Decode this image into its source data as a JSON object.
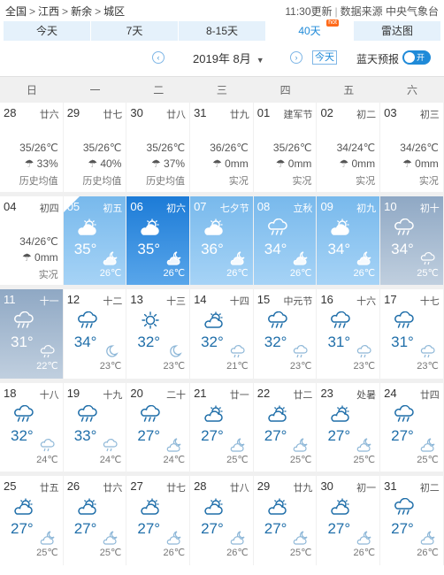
{
  "breadcrumb": {
    "items": [
      "全国",
      "江西",
      "新余",
      "城区"
    ],
    "sep": ">"
  },
  "update": {
    "time": "11:30更新",
    "source": "数据来源 中央气象台"
  },
  "tabs": [
    {
      "label": "今天",
      "active": false
    },
    {
      "label": "7天",
      "active": false
    },
    {
      "label": "8-15天",
      "active": false
    },
    {
      "label": "40天",
      "active": true,
      "badge": "hot"
    },
    {
      "label": "雷达图",
      "active": false
    }
  ],
  "controls": {
    "prev_icon": "‹",
    "next_icon": "›",
    "month": "2019年 8月",
    "caret": "▼",
    "today": "今天",
    "bluesky": "蓝天预报",
    "toggle": "开"
  },
  "weekdays": [
    "日",
    "一",
    "二",
    "三",
    "四",
    "五",
    "六"
  ],
  "history": [
    {
      "day": "28",
      "lunar": "廿六",
      "temp": "35/26℃",
      "prob": "33%",
      "note": "历史均值"
    },
    {
      "day": "29",
      "lunar": "廿七",
      "temp": "35/26℃",
      "prob": "40%",
      "note": "历史均值"
    },
    {
      "day": "30",
      "lunar": "廿八",
      "temp": "35/26℃",
      "prob": "37%",
      "note": "历史均值"
    },
    {
      "day": "31",
      "lunar": "廿九",
      "temp": "36/26℃",
      "prob": "0mm",
      "note": "实况"
    },
    {
      "day": "01",
      "lunar": "建军节",
      "temp": "35/26℃",
      "prob": "0mm",
      "note": "实况"
    },
    {
      "day": "02",
      "lunar": "初二",
      "temp": "34/24℃",
      "prob": "0mm",
      "note": "实况"
    },
    {
      "day": "03",
      "lunar": "初三",
      "temp": "34/26℃",
      "prob": "0mm",
      "note": "实况"
    },
    {
      "day": "04",
      "lunar": "初四",
      "temp": "34/26℃",
      "prob": "0mm",
      "note": "实况"
    }
  ],
  "forecast": [
    {
      "day": "05",
      "lunar": "初五",
      "hi": "35°",
      "lo": "26℃",
      "icon": "partly-cloudy",
      "night": "partly-cloudy-night",
      "style": "sky"
    },
    {
      "day": "06",
      "lunar": "初六",
      "hi": "35°",
      "lo": "26℃",
      "icon": "partly-cloudy",
      "night": "partly-cloudy-night",
      "style": "skydark"
    },
    {
      "day": "07",
      "lunar": "七夕节",
      "hi": "36°",
      "lo": "26℃",
      "icon": "partly-cloudy",
      "night": "partly-cloudy-night",
      "style": "sky"
    },
    {
      "day": "08",
      "lunar": "立秋",
      "hi": "34°",
      "lo": "26℃",
      "icon": "rain",
      "night": "partly-cloudy-night",
      "style": "sky"
    },
    {
      "day": "09",
      "lunar": "初九",
      "hi": "34°",
      "lo": "26℃",
      "icon": "partly-cloudy",
      "night": "partly-cloudy-night",
      "style": "sky"
    },
    {
      "day": "10",
      "lunar": "初十",
      "hi": "34°",
      "lo": "25℃",
      "icon": "rain",
      "night": "rain",
      "style": "grey"
    },
    {
      "day": "11",
      "lunar": "十一",
      "hi": "31°",
      "lo": "22℃",
      "icon": "rain",
      "night": "rain",
      "style": "grey"
    },
    {
      "day": "12",
      "lunar": "十二",
      "hi": "34°",
      "lo": "23℃",
      "icon": "rain",
      "night": "moon",
      "style": ""
    },
    {
      "day": "13",
      "lunar": "十三",
      "hi": "32°",
      "lo": "23℃",
      "icon": "sun",
      "night": "moon",
      "style": ""
    },
    {
      "day": "14",
      "lunar": "十四",
      "hi": "32°",
      "lo": "21℃",
      "icon": "partly-cloudy",
      "night": "rain",
      "style": ""
    },
    {
      "day": "15",
      "lunar": "中元节",
      "hi": "32°",
      "lo": "23℃",
      "icon": "rain",
      "night": "rain",
      "style": ""
    },
    {
      "day": "16",
      "lunar": "十六",
      "hi": "31°",
      "lo": "23℃",
      "icon": "rain",
      "night": "rain",
      "style": ""
    },
    {
      "day": "17",
      "lunar": "十七",
      "hi": "31°",
      "lo": "23℃",
      "icon": "rain",
      "night": "rain",
      "style": ""
    },
    {
      "day": "18",
      "lunar": "十八",
      "hi": "32°",
      "lo": "24℃",
      "icon": "rain",
      "night": "rain",
      "style": ""
    },
    {
      "day": "19",
      "lunar": "十九",
      "hi": "33°",
      "lo": "24℃",
      "icon": "rain",
      "night": "rain",
      "style": ""
    },
    {
      "day": "20",
      "lunar": "二十",
      "hi": "27°",
      "lo": "24℃",
      "icon": "rain",
      "night": "partly-cloudy-night",
      "style": ""
    },
    {
      "day": "21",
      "lunar": "廿一",
      "hi": "27°",
      "lo": "25℃",
      "icon": "partly-cloudy",
      "night": "partly-cloudy-night",
      "style": ""
    },
    {
      "day": "22",
      "lunar": "廿二",
      "hi": "27°",
      "lo": "25℃",
      "icon": "partly-cloudy",
      "night": "partly-cloudy-night",
      "style": ""
    },
    {
      "day": "23",
      "lunar": "处暑",
      "hi": "27°",
      "lo": "25℃",
      "icon": "partly-cloudy",
      "night": "partly-cloudy-night",
      "style": ""
    },
    {
      "day": "24",
      "lunar": "廿四",
      "hi": "27°",
      "lo": "25℃",
      "icon": "rain",
      "night": "partly-cloudy-night",
      "style": ""
    },
    {
      "day": "25",
      "lunar": "廿五",
      "hi": "27°",
      "lo": "25℃",
      "icon": "partly-cloudy",
      "night": "partly-cloudy-night",
      "style": ""
    },
    {
      "day": "26",
      "lunar": "廿六",
      "hi": "27°",
      "lo": "25℃",
      "icon": "partly-cloudy",
      "night": "partly-cloudy-night",
      "style": ""
    },
    {
      "day": "27",
      "lunar": "廿七",
      "hi": "27°",
      "lo": "26℃",
      "icon": "partly-cloudy",
      "night": "partly-cloudy-night",
      "style": ""
    },
    {
      "day": "28",
      "lunar": "廿八",
      "hi": "27°",
      "lo": "26℃",
      "icon": "partly-cloudy",
      "night": "partly-cloudy-night",
      "style": ""
    },
    {
      "day": "29",
      "lunar": "廿九",
      "hi": "27°",
      "lo": "25℃",
      "icon": "partly-cloudy",
      "night": "partly-cloudy-night",
      "style": ""
    },
    {
      "day": "30",
      "lunar": "初一",
      "hi": "27°",
      "lo": "26℃",
      "icon": "partly-cloudy",
      "night": "partly-cloudy-night",
      "style": ""
    },
    {
      "day": "31",
      "lunar": "初二",
      "hi": "27°",
      "lo": "26℃",
      "icon": "rain",
      "night": "partly-cloudy-night",
      "style": ""
    }
  ],
  "colors": {
    "accent": "#1f8ad8",
    "tab_bg": "#e5f1fb",
    "icon_day": "#1f6ea9",
    "icon_night": "#8fb8d8"
  }
}
